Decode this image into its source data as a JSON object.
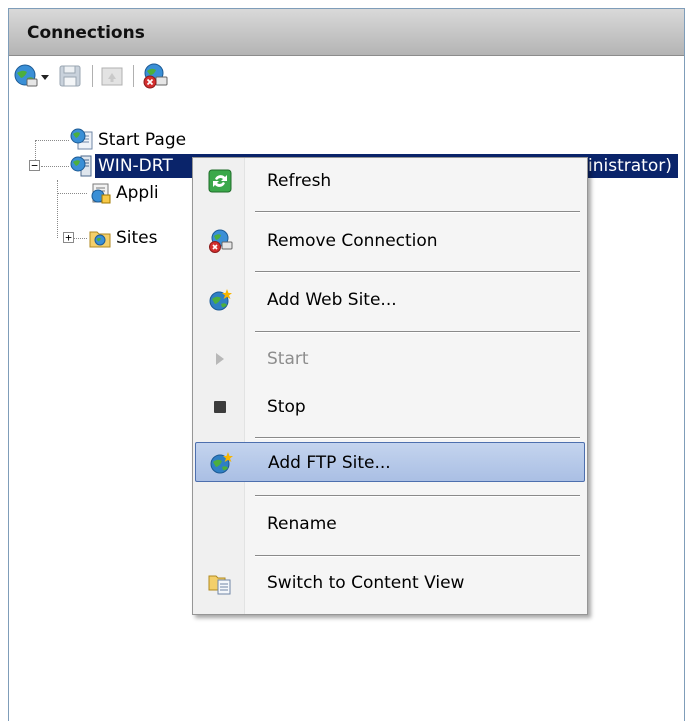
{
  "panel": {
    "title": "Connections"
  },
  "toolbar": {
    "buttons": [
      {
        "name": "connect",
        "icon": "globe-connect-icon"
      },
      {
        "name": "dropdown",
        "icon": "chevron-down-icon"
      },
      {
        "name": "save",
        "icon": "floppy-disk-icon"
      },
      {
        "name": "up",
        "icon": "folder-up-icon"
      },
      {
        "name": "disconnect",
        "icon": "disconnect-icon"
      }
    ]
  },
  "tree": {
    "start_page": "Start Page",
    "server": "WIN-DRT",
    "server_suffix": "inistrator)",
    "app_pools": "Appli",
    "sites": "Sites"
  },
  "context_menu": {
    "items": [
      {
        "label": "Refresh",
        "icon": "refresh-icon",
        "enabled": true
      },
      {
        "label": "Remove Connection",
        "icon": "remove-connection-icon",
        "enabled": true
      },
      {
        "label": "Add Web Site...",
        "icon": "add-web-site-icon",
        "enabled": true
      },
      {
        "label": "Start",
        "icon": "start-icon",
        "enabled": false
      },
      {
        "label": "Stop",
        "icon": "stop-icon",
        "enabled": true
      },
      {
        "label": "Add FTP Site...",
        "icon": "add-ftp-site-icon",
        "enabled": true,
        "highlighted": true
      },
      {
        "label": "Rename",
        "icon": "",
        "enabled": true
      },
      {
        "label": "Switch to Content View",
        "icon": "content-view-icon",
        "enabled": true
      }
    ]
  },
  "colors": {
    "selection": "#0a246a",
    "menu_highlight": "#b8cbea",
    "header": "#c8c8c8"
  }
}
